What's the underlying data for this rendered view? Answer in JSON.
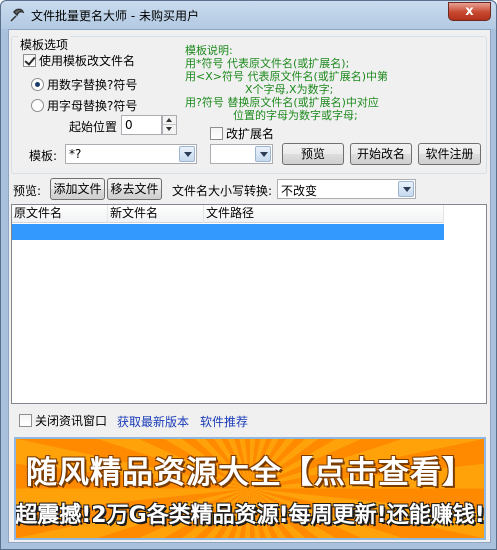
{
  "window": {
    "title": "文件批量更名大师 - 未购买用户",
    "close_label": "x"
  },
  "template_options": {
    "group_title": "模板选项",
    "use_template_label": "使用模板改文件名",
    "use_template_checked": true,
    "replace_digit_label": "用数字替换?符号",
    "replace_letter_label": "用字母替换?符号",
    "selected_mode": "digit",
    "start_pos_label": "起始位置",
    "start_pos_value": "0",
    "help_title": "模板说明:",
    "help_lines": [
      "用*符号  代表原文件名(或扩展名);",
      "用<X>符号  代表原文件名(或扩展名)中第",
      "X个字母,X为数字;",
      "用?符号  替换原文件名(或扩展名)中对应",
      "位置的字母为数字或字母;"
    ],
    "change_ext_label": "改扩展名",
    "change_ext_checked": false,
    "template_label": "模板:",
    "template_value": "*?",
    "ext_value": ""
  },
  "buttons": {
    "preview": "预览",
    "start_rename": "开始改名",
    "register": "软件注册",
    "add_files": "添加文件",
    "remove_files": "移去文件"
  },
  "toolbar": {
    "preview_label": "预览:",
    "case_label": "文件名大小写转换:",
    "case_value": "不改变"
  },
  "list": {
    "columns": [
      "原文件名",
      "新文件名",
      "文件路径"
    ]
  },
  "footer": {
    "close_info_label": "关闭资讯窗口",
    "close_info_checked": false,
    "get_latest": "获取最新版本",
    "recommend": "软件推荐"
  },
  "banner": {
    "line1": "随风精品资源大全【点击查看】",
    "line2": "超震撼!2万G各类精品资源!每周更新!还能赚钱!"
  }
}
